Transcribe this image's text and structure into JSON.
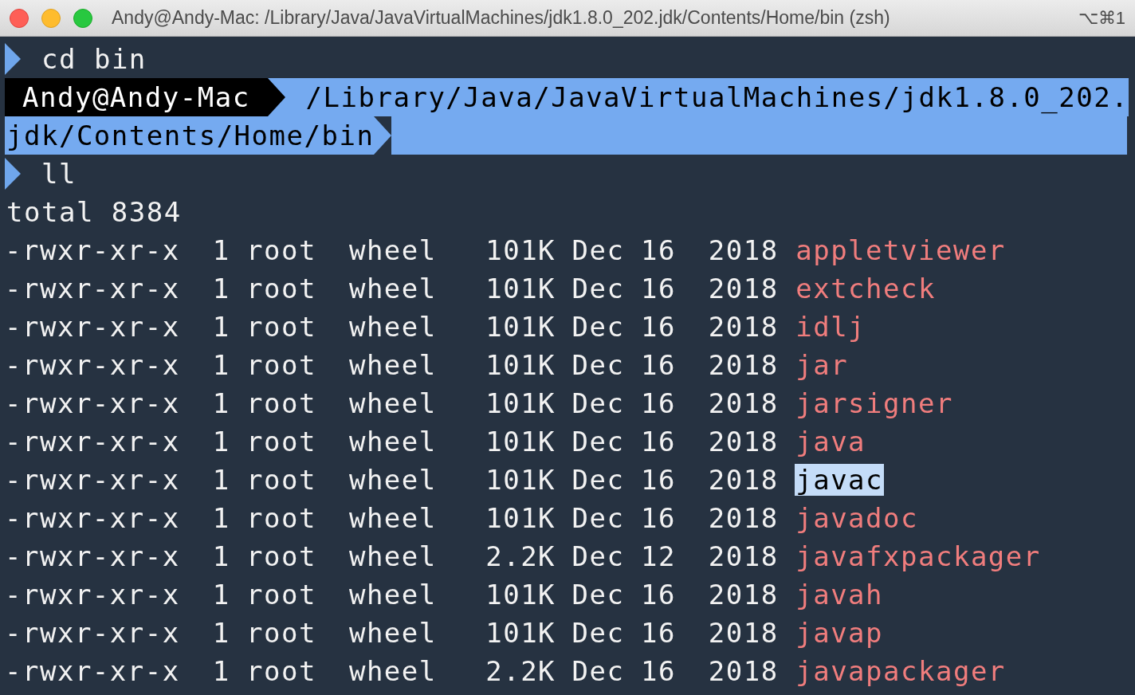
{
  "window": {
    "title": "Andy@Andy-Mac: /Library/Java/JavaVirtualMachines/jdk1.8.0_202.jdk/Contents/Home/bin (zsh)",
    "shortcut": "⌥⌘1"
  },
  "lines": [
    {
      "kind": "command",
      "text": "cd bin"
    },
    {
      "kind": "prompt",
      "user": "Andy@Andy-Mac",
      "path_lines": [
        "/Library/Java/JavaVirtualMachines/jdk1.8.0_202.",
        "jdk/Contents/Home/bin"
      ]
    },
    {
      "kind": "command",
      "text": "ll"
    },
    {
      "kind": "output",
      "text": "total 8384"
    }
  ],
  "listing": [
    {
      "perms": "-rwxr-xr-x",
      "links": "1",
      "owner": "root",
      "group": "wheel",
      "size": "101K",
      "month": "Dec",
      "day": "16",
      "year": "2018",
      "name": "appletviewer",
      "selected": false
    },
    {
      "perms": "-rwxr-xr-x",
      "links": "1",
      "owner": "root",
      "group": "wheel",
      "size": "101K",
      "month": "Dec",
      "day": "16",
      "year": "2018",
      "name": "extcheck",
      "selected": false
    },
    {
      "perms": "-rwxr-xr-x",
      "links": "1",
      "owner": "root",
      "group": "wheel",
      "size": "101K",
      "month": "Dec",
      "day": "16",
      "year": "2018",
      "name": "idlj",
      "selected": false
    },
    {
      "perms": "-rwxr-xr-x",
      "links": "1",
      "owner": "root",
      "group": "wheel",
      "size": "101K",
      "month": "Dec",
      "day": "16",
      "year": "2018",
      "name": "jar",
      "selected": false
    },
    {
      "perms": "-rwxr-xr-x",
      "links": "1",
      "owner": "root",
      "group": "wheel",
      "size": "101K",
      "month": "Dec",
      "day": "16",
      "year": "2018",
      "name": "jarsigner",
      "selected": false
    },
    {
      "perms": "-rwxr-xr-x",
      "links": "1",
      "owner": "root",
      "group": "wheel",
      "size": "101K",
      "month": "Dec",
      "day": "16",
      "year": "2018",
      "name": "java",
      "selected": false
    },
    {
      "perms": "-rwxr-xr-x",
      "links": "1",
      "owner": "root",
      "group": "wheel",
      "size": "101K",
      "month": "Dec",
      "day": "16",
      "year": "2018",
      "name": "javac",
      "selected": true
    },
    {
      "perms": "-rwxr-xr-x",
      "links": "1",
      "owner": "root",
      "group": "wheel",
      "size": "101K",
      "month": "Dec",
      "day": "16",
      "year": "2018",
      "name": "javadoc",
      "selected": false
    },
    {
      "perms": "-rwxr-xr-x",
      "links": "1",
      "owner": "root",
      "group": "wheel",
      "size": "2.2K",
      "month": "Dec",
      "day": "12",
      "year": "2018",
      "name": "javafxpackager",
      "selected": false
    },
    {
      "perms": "-rwxr-xr-x",
      "links": "1",
      "owner": "root",
      "group": "wheel",
      "size": "101K",
      "month": "Dec",
      "day": "16",
      "year": "2018",
      "name": "javah",
      "selected": false
    },
    {
      "perms": "-rwxr-xr-x",
      "links": "1",
      "owner": "root",
      "group": "wheel",
      "size": "101K",
      "month": "Dec",
      "day": "16",
      "year": "2018",
      "name": "javap",
      "selected": false
    },
    {
      "perms": "-rwxr-xr-x",
      "links": "1",
      "owner": "root",
      "group": "wheel",
      "size": "2.2K",
      "month": "Dec",
      "day": "16",
      "year": "2018",
      "name": "javapackager",
      "selected": false
    }
  ]
}
